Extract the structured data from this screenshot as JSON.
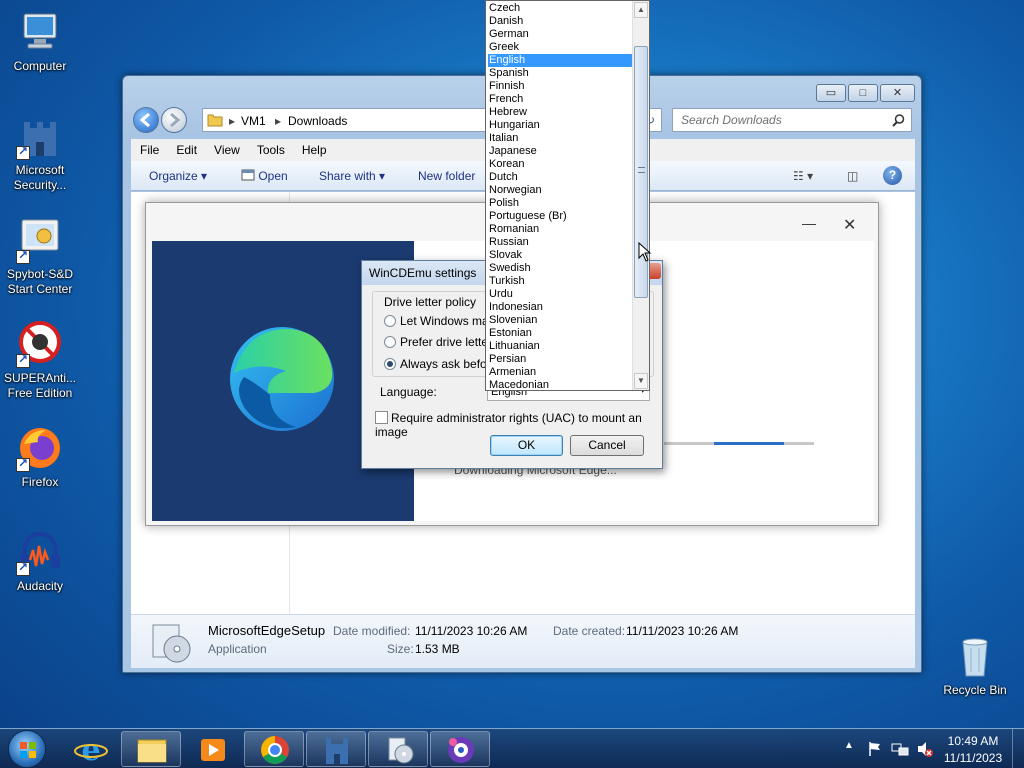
{
  "desktop": {
    "icons": [
      {
        "label": "Computer"
      },
      {
        "label": "Microsoft Security..."
      },
      {
        "label": "Spybot-S&D Start Center"
      },
      {
        "label": "SUPERAnti... Free Edition"
      },
      {
        "label": "Firefox"
      },
      {
        "label": "Audacity"
      },
      {
        "label": "Recycle Bin"
      }
    ]
  },
  "explorer": {
    "breadcrumb": [
      "VM1",
      "Downloads"
    ],
    "search_placeholder": "Search Downloads",
    "menu": [
      "File",
      "Edit",
      "View",
      "Tools",
      "Help"
    ],
    "toolbar": {
      "organize": "Organize",
      "open": "Open",
      "share": "Share with",
      "new_folder": "New folder"
    },
    "details": {
      "name": "MicrosoftEdgeSetup",
      "type": "Application",
      "modified_label": "Date modified:",
      "modified_value": "11/11/2023 10:26 AM",
      "created_label": "Date created:",
      "created_value": "11/11/2023 10:26 AM",
      "size_label": "Size:",
      "size_value": "1.53 MB"
    }
  },
  "edge_installer": {
    "status": "Downloading Microsoft Edge...",
    "progress": 0.52,
    "close_glyph": "✕",
    "min_glyph": "—"
  },
  "wincdemu": {
    "title": "WinCDEmu settings",
    "group_label": "Drive letter policy",
    "options": [
      {
        "label": "Let Windows mana",
        "selected": false
      },
      {
        "label": "Prefer drive letter",
        "selected": false
      },
      {
        "label": "Always ask before",
        "selected": true
      }
    ],
    "language_label": "Language:",
    "language_value": "English",
    "uac_label": "Require administrator rights (UAC) to mount an image",
    "uac_checked": false,
    "ok": "OK",
    "cancel": "Cancel"
  },
  "language_list": {
    "items": [
      "Czech",
      "Danish",
      "German",
      "Greek",
      "English",
      "Spanish",
      "Finnish",
      "French",
      "Hebrew",
      "Hungarian",
      "Italian",
      "Japanese",
      "Korean",
      "Dutch",
      "Norwegian",
      "Polish",
      "Portuguese (Br)",
      "Romanian",
      "Russian",
      "Slovak",
      "Swedish",
      "Turkish",
      "Urdu",
      "Indonesian",
      "Slovenian",
      "Estonian",
      "Lithuanian",
      "Persian",
      "Armenian",
      "Macedonian"
    ],
    "selected": "English"
  },
  "taskbar": {
    "time": "10:49 AM",
    "date": "11/11/2023"
  },
  "colors": {
    "selection": "#3399ff",
    "edge_panel": "#1b3a70",
    "progress": "#2a6fc9"
  }
}
